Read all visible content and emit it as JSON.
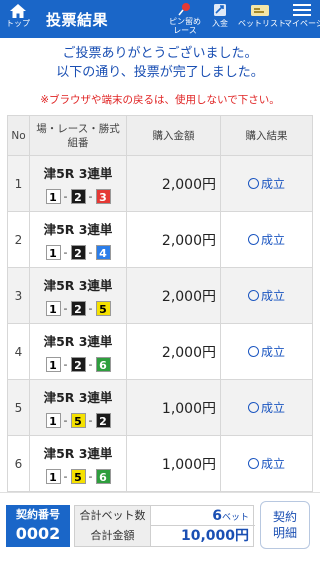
{
  "header": {
    "home_label": "トップ",
    "title": "投票結果",
    "pin_label_1": "ピン留め",
    "pin_label_2": "レース",
    "deposit_label": "入金",
    "betlist_label": "ベットリスト",
    "mypage_label": "マイページ",
    "color": "#1a66c8"
  },
  "messages": {
    "line1": "ご投票ありがとうございました。",
    "line2": "以下の通り、投票が完了しました。",
    "warning": "※ブラウザや端末の戻るは、使用しないで下さい。"
  },
  "table": {
    "headers": {
      "no": "No",
      "race_1": "場・レース・勝式",
      "race_2": "組番",
      "amount": "購入金額",
      "result": "購入結果"
    },
    "rows": [
      {
        "no": "1",
        "race": "津5R 3連単",
        "combo": [
          "1",
          "2",
          "3"
        ],
        "amount": "2,000円",
        "result": "成立"
      },
      {
        "no": "2",
        "race": "津5R 3連単",
        "combo": [
          "1",
          "2",
          "4"
        ],
        "amount": "2,000円",
        "result": "成立"
      },
      {
        "no": "3",
        "race": "津5R 3連単",
        "combo": [
          "1",
          "2",
          "5"
        ],
        "amount": "2,000円",
        "result": "成立"
      },
      {
        "no": "4",
        "race": "津5R 3連単",
        "combo": [
          "1",
          "2",
          "6"
        ],
        "amount": "2,000円",
        "result": "成立"
      },
      {
        "no": "5",
        "race": "津5R 3連単",
        "combo": [
          "1",
          "5",
          "2"
        ],
        "amount": "1,000円",
        "result": "成立"
      },
      {
        "no": "6",
        "race": "津5R 3連単",
        "combo": [
          "1",
          "5",
          "6"
        ],
        "amount": "1,000円",
        "result": "成立"
      }
    ],
    "separator": "-",
    "boat_colors": {
      "1": {
        "bg": "#ffffff",
        "fg": "#000000"
      },
      "2": {
        "bg": "#1a1a1a",
        "fg": "#ffffff"
      },
      "3": {
        "bg": "#e53935",
        "fg": "#ffffff"
      },
      "4": {
        "bg": "#2b7de9",
        "fg": "#ffffff"
      },
      "5": {
        "bg": "#f5e100",
        "fg": "#000000"
      },
      "6": {
        "bg": "#2e9e3e",
        "fg": "#ffffff"
      }
    }
  },
  "footer": {
    "contract_label": "契約番号",
    "contract_no": "0002",
    "total_bets_label": "合計ベット数",
    "total_bets": "6",
    "total_bets_unit": "ベット",
    "total_amount_label": "合計金額",
    "total_amount": "10,000円",
    "detail_line1": "契約",
    "detail_line2": "明細"
  }
}
